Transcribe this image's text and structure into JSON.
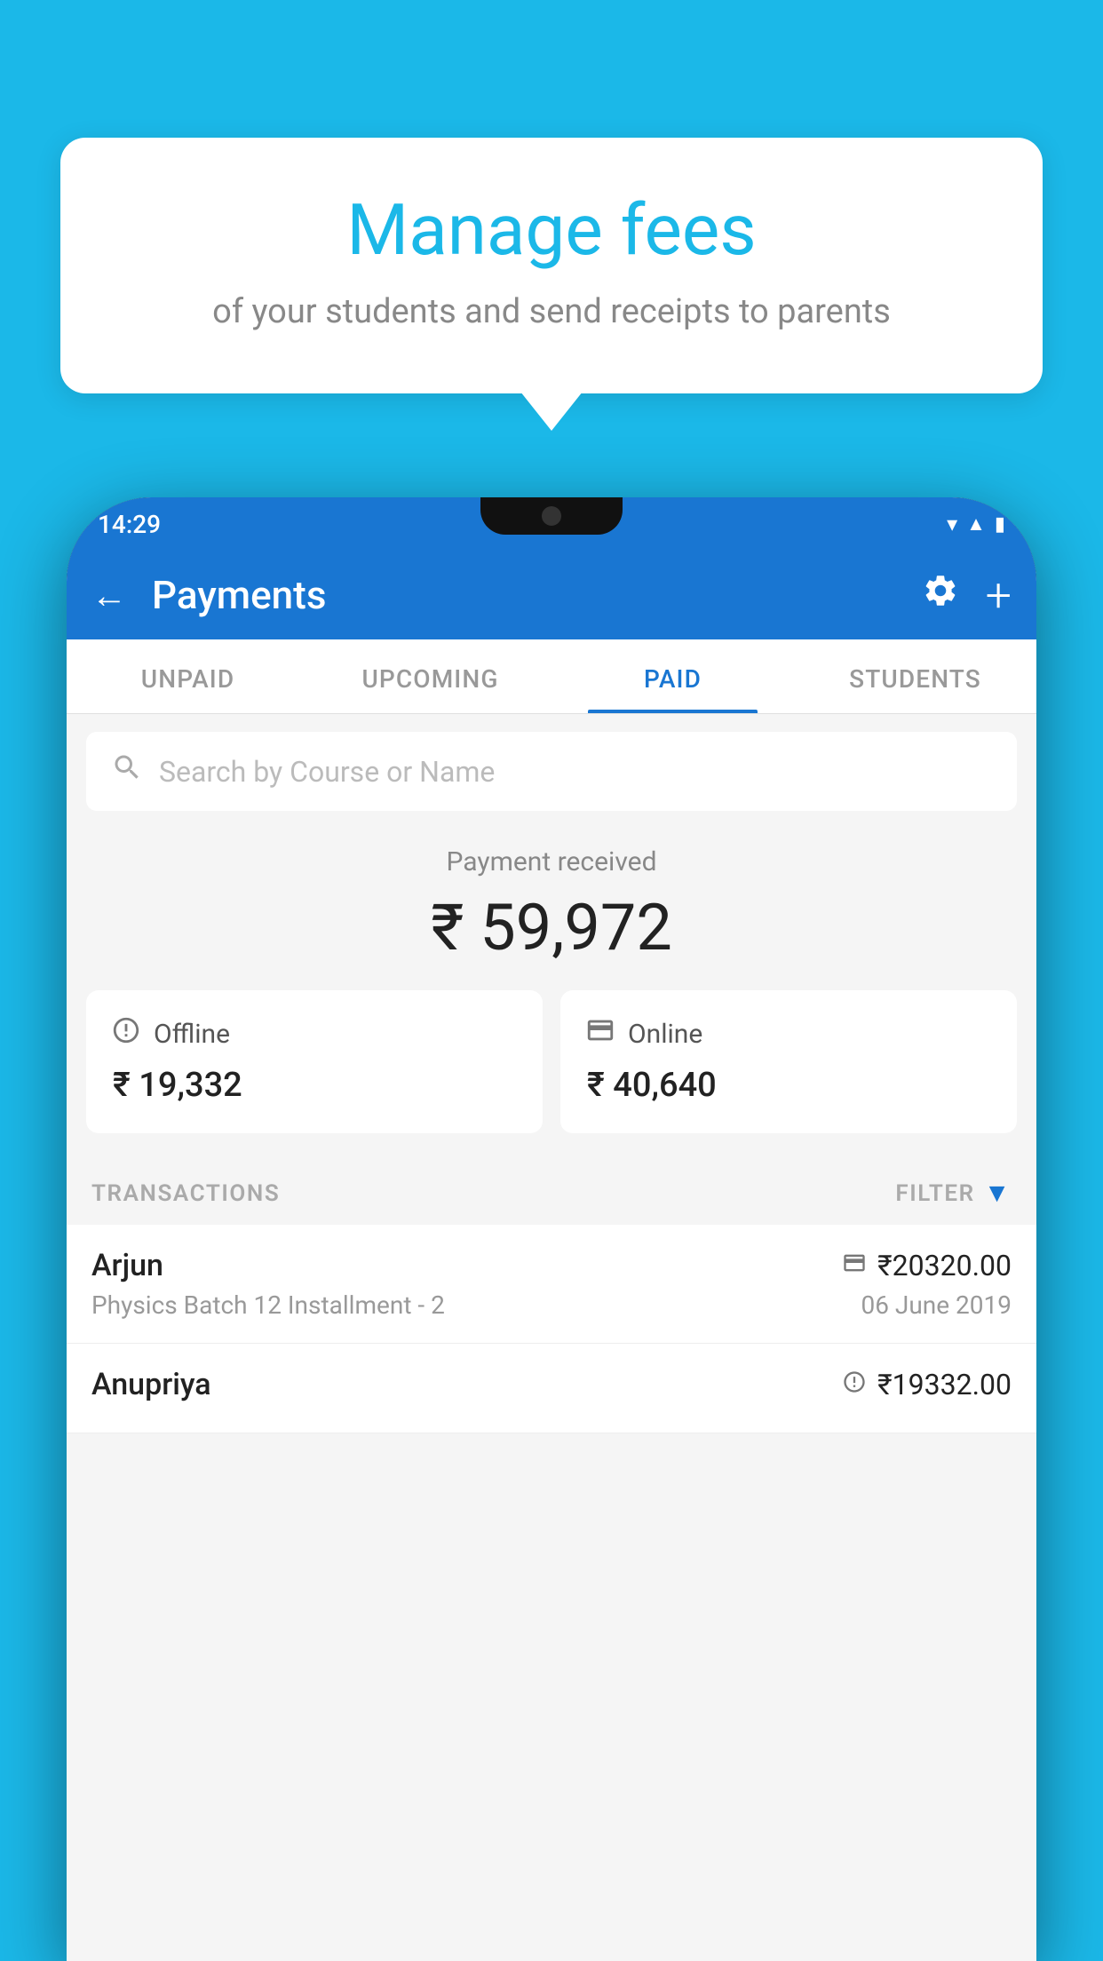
{
  "background_color": "#1bb8e8",
  "bubble": {
    "title": "Manage fees",
    "subtitle": "of your students and send receipts to parents"
  },
  "status_bar": {
    "time": "14:29",
    "icons": [
      "wifi",
      "signal",
      "battery"
    ]
  },
  "app_bar": {
    "title": "Payments",
    "back_label": "←",
    "settings_label": "⚙",
    "add_label": "+"
  },
  "tabs": [
    {
      "label": "UNPAID",
      "active": false
    },
    {
      "label": "UPCOMING",
      "active": false
    },
    {
      "label": "PAID",
      "active": true
    },
    {
      "label": "STUDENTS",
      "active": false
    }
  ],
  "search": {
    "placeholder": "Search by Course or Name"
  },
  "payment_received": {
    "label": "Payment received",
    "amount": "₹ 59,972",
    "offline": {
      "label": "Offline",
      "amount": "₹ 19,332"
    },
    "online": {
      "label": "Online",
      "amount": "₹ 40,640"
    }
  },
  "transactions": {
    "header": "TRANSACTIONS",
    "filter": "FILTER",
    "rows": [
      {
        "name": "Arjun",
        "amount": "₹20320.00",
        "mode": "card",
        "description": "Physics Batch 12 Installment - 2",
        "date": "06 June 2019"
      },
      {
        "name": "Anupriya",
        "amount": "₹19332.00",
        "mode": "cash",
        "description": "",
        "date": ""
      }
    ]
  }
}
